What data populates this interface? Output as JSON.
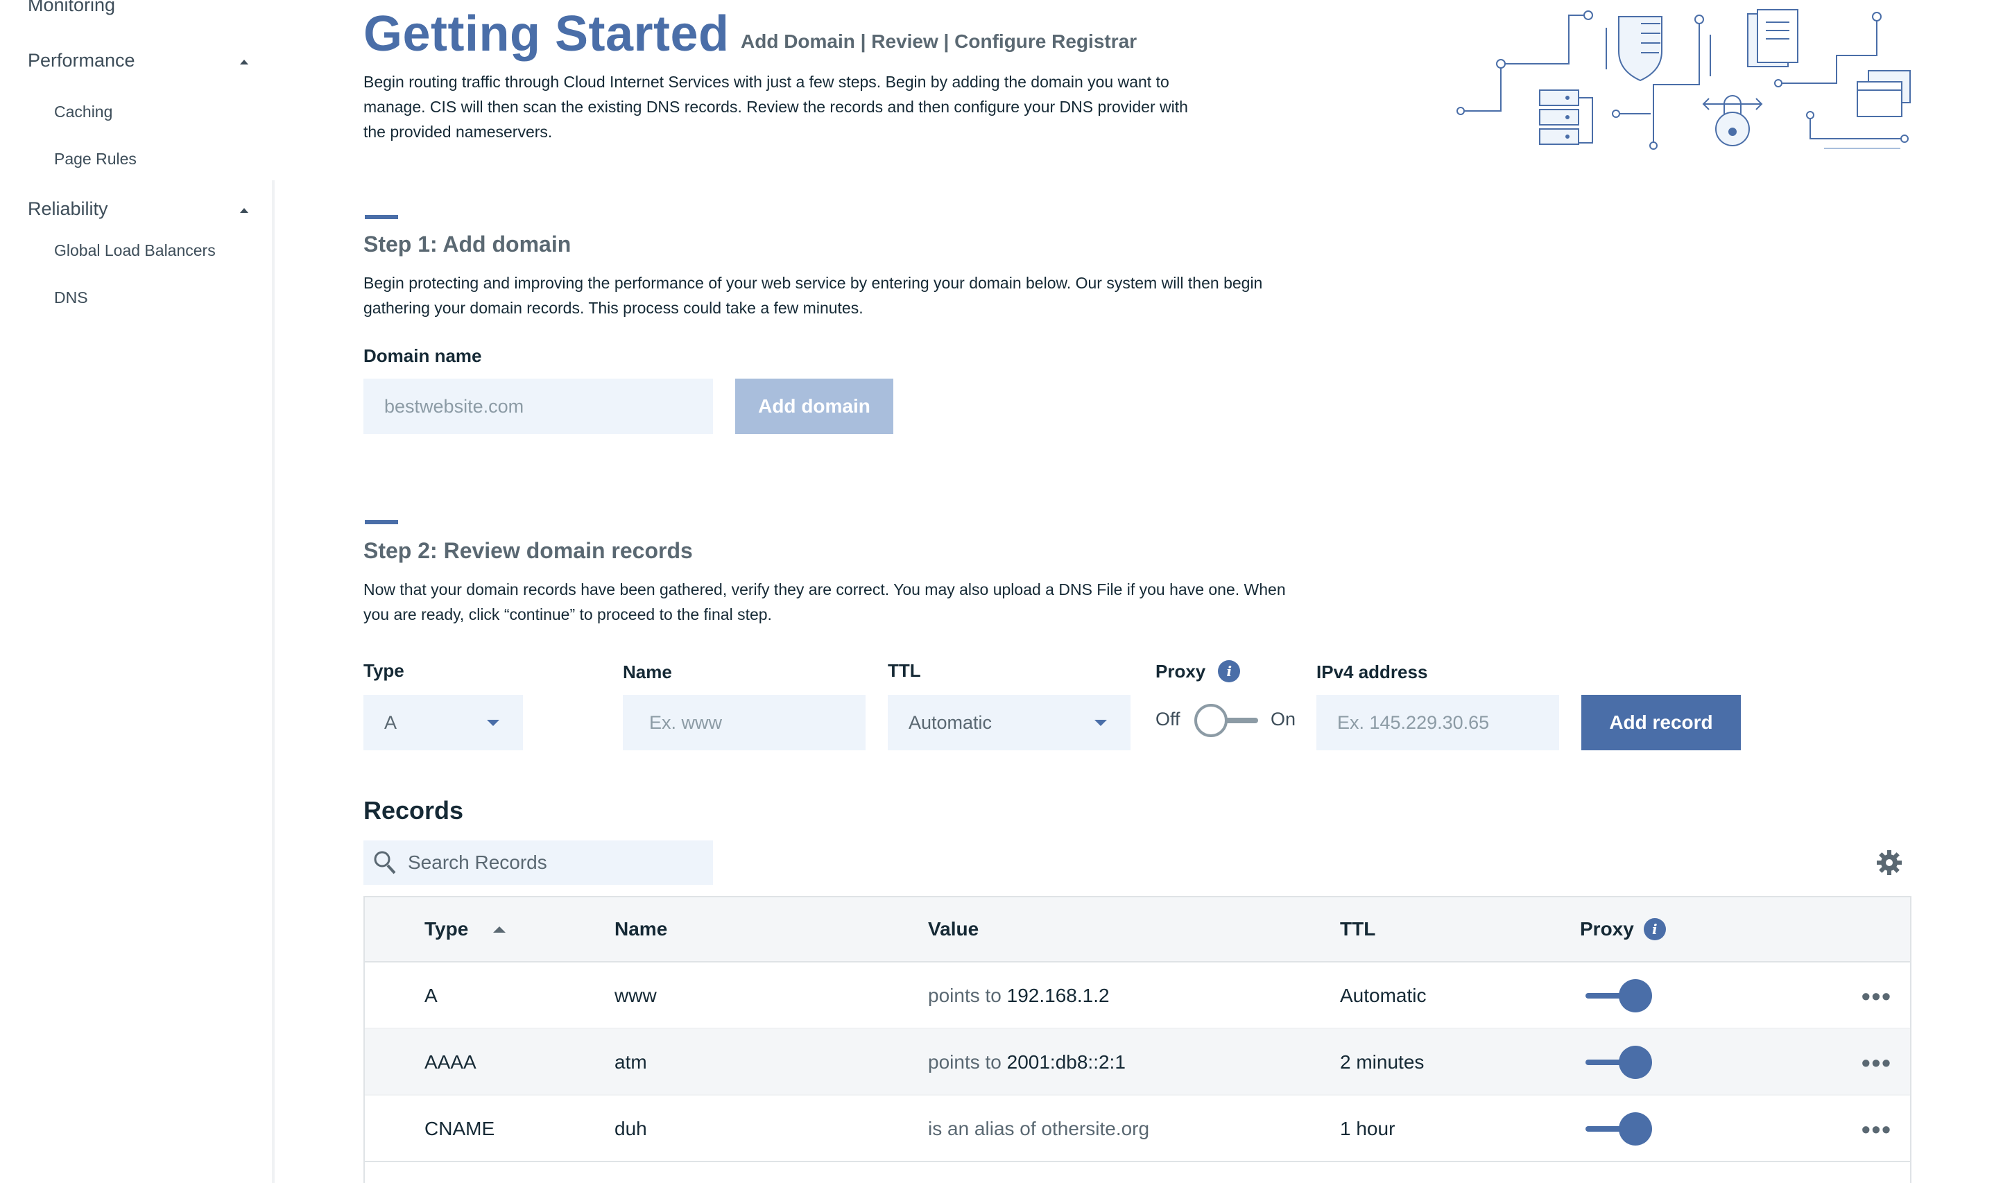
{
  "sidebar": {
    "top_item": "Monitoring",
    "sections": [
      {
        "label": "Performance",
        "items": [
          "Caching",
          "Page Rules"
        ]
      },
      {
        "label": "Reliability",
        "items": [
          "Global Load Balancers",
          "DNS"
        ]
      }
    ]
  },
  "header": {
    "title": "Getting Started",
    "steps": "Add Domain | Review | Configure Registrar",
    "intro": "Begin routing traffic through Cloud Internet Services with just a few steps. Begin by adding the domain you want to manage. CIS will then scan the existing DNS records. Review the records and then configure your DNS provider with the provided nameservers."
  },
  "step1": {
    "title": "Step 1: Add domain",
    "description": "Begin protecting and improving the performance of your web service by entering your domain below. Our system will then begin gathering your domain records. This process could take a few minutes.",
    "domain_label": "Domain name",
    "domain_placeholder": "bestwebsite.com",
    "add_button": "Add domain"
  },
  "step2": {
    "title": "Step 2: Review domain records",
    "description": "Now that your domain records have been gathered, verify they are correct. You may also upload a DNS File if you have one. When you are ready, click “continue” to proceed to the final step.",
    "type_label": "Type",
    "type_value": "A",
    "name_label": "Name",
    "name_placeholder": "Ex. www",
    "ttl_label": "TTL",
    "ttl_value": "Automatic",
    "proxy_label": "Proxy",
    "proxy_off": "Off",
    "proxy_on": "On",
    "ipv4_label": "IPv4 address",
    "ipv4_placeholder": "Ex. 145.229.30.65",
    "add_record_button": "Add record"
  },
  "records": {
    "title": "Records",
    "search_placeholder": "Search Records",
    "columns": {
      "type": "Type",
      "name": "Name",
      "value": "Value",
      "ttl": "TTL",
      "proxy": "Proxy"
    },
    "rows": [
      {
        "type": "A",
        "name": "www",
        "value_prefix": "points to",
        "value": "192.168.1.2",
        "ttl": "Automatic",
        "proxy": true
      },
      {
        "type": "AAAA",
        "name": "atm",
        "value_prefix": "points to",
        "value": "2001:db8::2:1",
        "ttl": "2 minutes",
        "proxy": true
      },
      {
        "type": "CNAME",
        "name": "duh",
        "value_prefix": "is an alias of",
        "value": "othersite.org",
        "ttl": "1 hour",
        "proxy": true
      }
    ]
  },
  "colors": {
    "accent": "#4a6ea8",
    "input_bg": "#eef4fb",
    "disabled_button": "#a9bedc"
  }
}
